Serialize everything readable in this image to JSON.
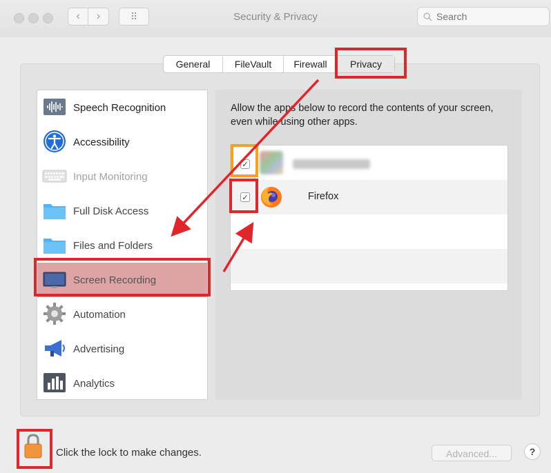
{
  "window": {
    "title": "Security & Privacy",
    "back_glyph": "‹",
    "forward_glyph": "›",
    "grid_glyph": "⠿",
    "search_placeholder": "Search",
    "search_value": ""
  },
  "tabs": [
    {
      "label": "General",
      "active": false
    },
    {
      "label": "FileVault",
      "active": false
    },
    {
      "label": "Firewall",
      "active": false
    },
    {
      "label": "Privacy",
      "active": true
    }
  ],
  "sidebar": {
    "items": [
      {
        "label": "Speech Recognition",
        "icon": "waveform-icon"
      },
      {
        "label": "Accessibility",
        "icon": "accessibility-icon"
      },
      {
        "label": "Input Monitoring",
        "icon": "keyboard-icon"
      },
      {
        "label": "Full Disk Access",
        "icon": "folder-icon"
      },
      {
        "label": "Files and Folders",
        "icon": "folder-icon"
      },
      {
        "label": "Screen Recording",
        "icon": "display-icon",
        "selected": true
      },
      {
        "label": "Automation",
        "icon": "gear-icon"
      },
      {
        "label": "Advertising",
        "icon": "megaphone-icon"
      },
      {
        "label": "Analytics",
        "icon": "bar-chart-icon"
      }
    ]
  },
  "main": {
    "description": "Allow the apps below to record the contents of your screen, even while using other apps.",
    "apps": [
      {
        "name": "",
        "checked": true,
        "blurred": true
      },
      {
        "name": "Firefox",
        "checked": true,
        "icon": "firefox-icon"
      }
    ],
    "check_glyph": "✓"
  },
  "footer": {
    "lock_text": "Click the lock to make changes.",
    "advanced_label": "Advanced...",
    "help_label": "?"
  },
  "colors": {
    "highlight_red": "#e0252b",
    "highlight_orange": "#f5a11c",
    "selected_row": "#dda3a5",
    "lock_orange": "#f0953a"
  }
}
